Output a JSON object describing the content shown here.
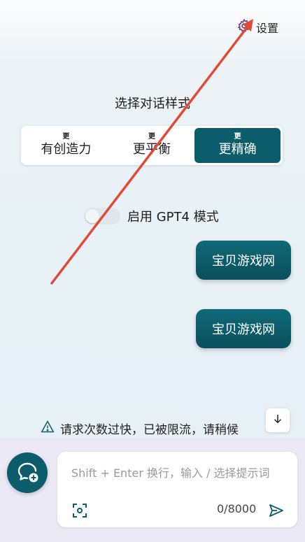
{
  "header": {
    "settings_label": "设置"
  },
  "style_selector": {
    "title": "选择对话样式",
    "options": [
      {
        "small": "更",
        "label": "有创造力"
      },
      {
        "small": "更",
        "label": "更平衡"
      },
      {
        "small": "更",
        "label": "更精确"
      }
    ],
    "selected_index": 2
  },
  "gpt4": {
    "label": "启用 GPT4 模式",
    "enabled": false
  },
  "messages": [
    {
      "text": "宝贝游戏网"
    },
    {
      "text": "宝贝游戏网"
    }
  ],
  "notice": {
    "text": "请求次数过快，已被限流，请稍候"
  },
  "composer": {
    "placeholder": "Shift + Enter 换行，输入 / 选择提示词",
    "counter": "0/8000"
  },
  "colors": {
    "accent": "#0c5d6b",
    "annotation_arrow": "#e04a36"
  },
  "icons": {
    "settings": "gear-icon",
    "warning": "warning-icon",
    "scroll_down": "arrow-down-icon",
    "new_chat": "chat-plus-icon",
    "image": "image-scan-icon",
    "send": "send-icon"
  }
}
